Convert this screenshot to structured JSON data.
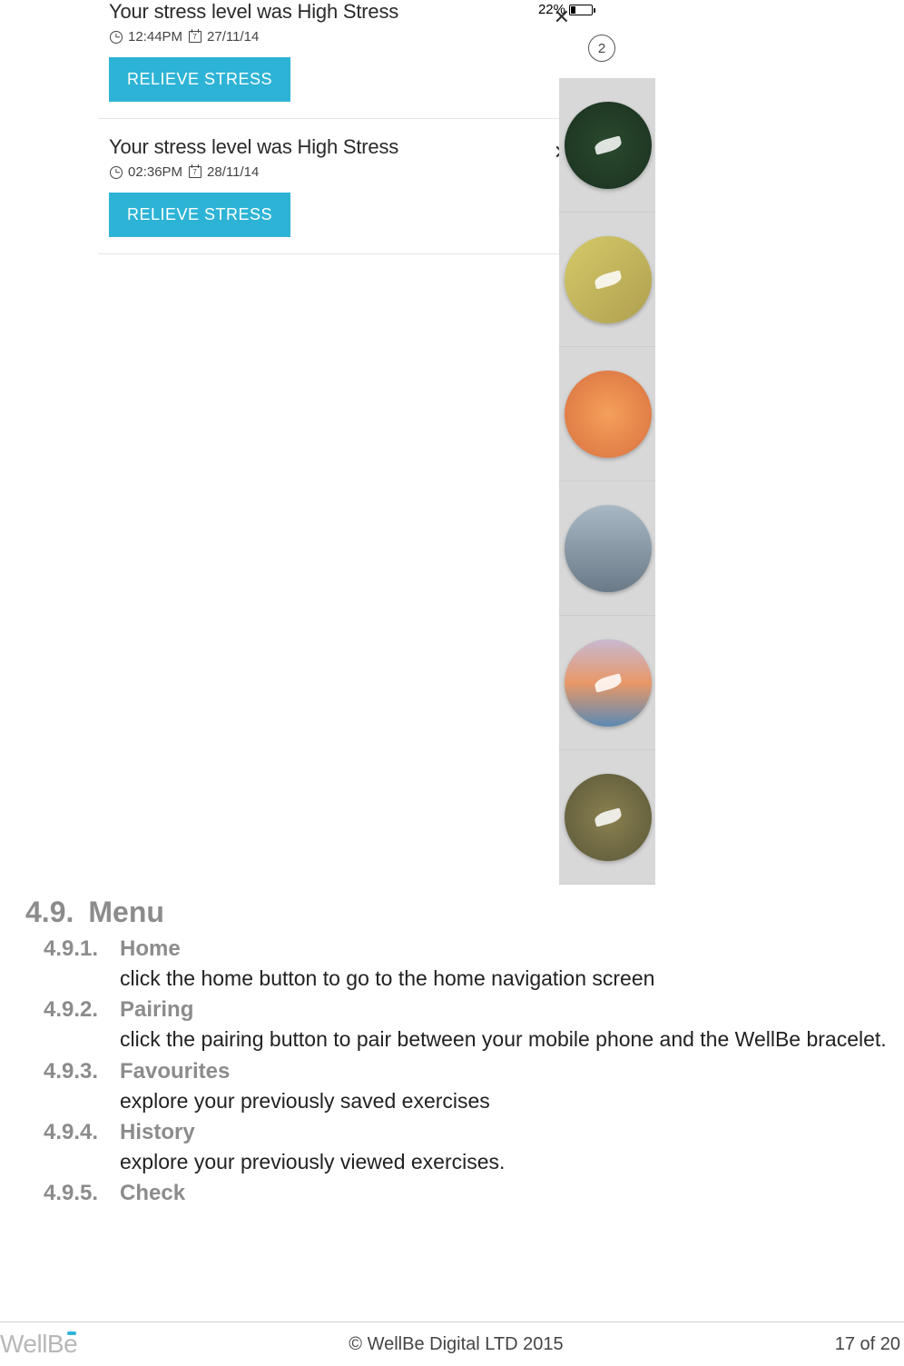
{
  "status_bar": {
    "battery_pct": "22%"
  },
  "badge_count": "2",
  "notifications": [
    {
      "title": "Your stress level was High Stress",
      "time": "12:44PM",
      "date": "27/11/14",
      "button": "RELIEVE STRESS"
    },
    {
      "title": "Your stress level was High Stress",
      "time": "02:36PM",
      "date": "28/11/14",
      "button": "RELIEVE STRESS"
    }
  ],
  "doc": {
    "section_num": "4.9.",
    "section_title": "Menu",
    "items": [
      {
        "num": "4.9.1.",
        "title": "Home",
        "body": "click the home button to go to the home navigation screen"
      },
      {
        "num": "4.9.2.",
        "title": "Pairing",
        "body": "click the pairing button to pair between your mobile phone and the WellBe bracelet."
      },
      {
        "num": "4.9.3.",
        "title": "Favourites",
        "body": "explore your previously saved exercises"
      },
      {
        "num": "4.9.4.",
        "title": "History",
        "body": "explore your previously viewed exercises."
      },
      {
        "num": "4.9.5.",
        "title": "Check",
        "body": ""
      }
    ]
  },
  "footer": {
    "logo": "WellBe",
    "copyright": "© WellBe Digital LTD 2015",
    "page": "17 of 20"
  }
}
